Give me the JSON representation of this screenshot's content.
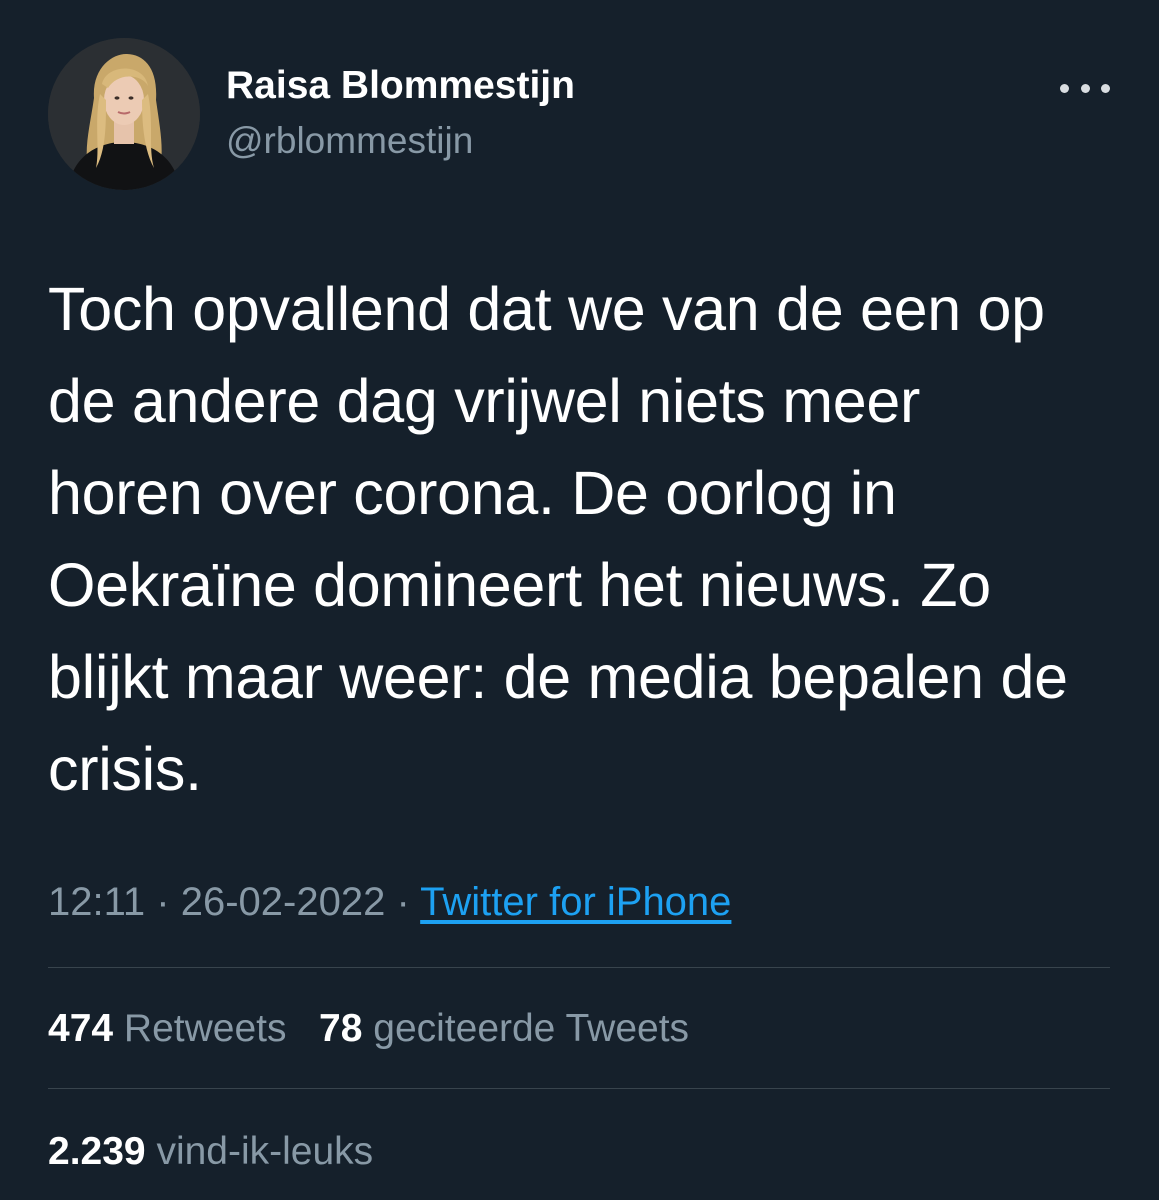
{
  "author": {
    "display_name": "Raisa Blommestijn",
    "handle": "@rblommestijn",
    "avatar_icon": "profile-photo"
  },
  "tweet": {
    "lines": [
      "Toch opvallend dat we van de een op",
      "de andere dag vrijwel niets meer",
      "horen over corona. De oorlog in",
      "Oekraïne domineert het nieuws. Zo",
      "blijkt maar weer: de media bepalen de",
      "crisis."
    ]
  },
  "meta": {
    "time": "12:11",
    "separator": "·",
    "date": "26-02-2022",
    "source": "Twitter for iPhone"
  },
  "stats": {
    "retweets_count": "474",
    "retweets_label": "Retweets",
    "quotes_count": "78",
    "quotes_label": "geciteerde Tweets",
    "likes_count": "2.239",
    "likes_label": "vind-ik-leuks"
  },
  "colors": {
    "background": "#15202b",
    "secondary_text": "#8899a6",
    "link": "#1da1f2",
    "divider": "#38444d"
  }
}
